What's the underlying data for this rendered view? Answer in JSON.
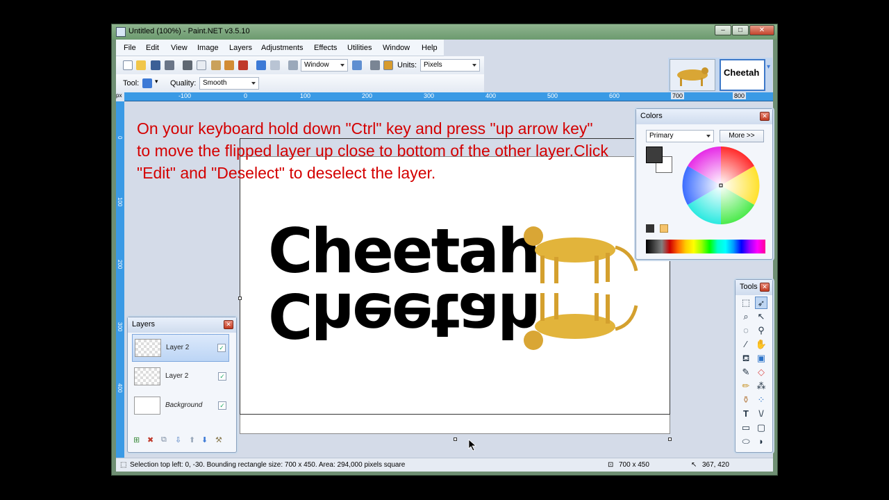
{
  "window": {
    "title": "Untitled (100%) - Paint.NET v3.5.10",
    "buttons": {
      "minimize": "–",
      "maximize": "□",
      "close": "✕"
    }
  },
  "menu": [
    "File",
    "Edit",
    "View",
    "Image",
    "Layers",
    "Adjustments",
    "Effects",
    "Utilities",
    "Window",
    "Help"
  ],
  "toolbar": {
    "window_combo": "Window",
    "units_label": "Units:",
    "units_value": "Pixels",
    "tool_label": "Tool:",
    "quality_label": "Quality:",
    "quality_value": "Smooth"
  },
  "ruler": {
    "unit": "px",
    "h_ticks": [
      "-100",
      "0",
      "100",
      "200",
      "300",
      "400",
      "500",
      "600",
      "700",
      "800"
    ],
    "v_ticks": [
      "0",
      "100",
      "200",
      "300",
      "400"
    ]
  },
  "instruction": "On your keyboard hold down \"Ctrl\" key and press \"up arrow key\" to move the flipped layer up close to bottom of the other layer.Click \"Edit\" and \"Deselect\" to deselect the layer.",
  "canvas": {
    "word": "Cheetah",
    "reflection": "Cheetah"
  },
  "colors_panel": {
    "title": "Colors",
    "primary_combo": "Primary",
    "more_button": "More >>",
    "primary_color": "#3c3c3c",
    "secondary_color": "#ffffff"
  },
  "layers_panel": {
    "title": "Layers",
    "layers": [
      {
        "name": "Layer 2",
        "visible": true,
        "selected": true
      },
      {
        "name": "Layer 2",
        "visible": true,
        "selected": false
      },
      {
        "name": "Background",
        "visible": true,
        "selected": false
      }
    ]
  },
  "tools_panel": {
    "title": "Tools"
  },
  "status": {
    "text": "Selection top left: 0, -30. Bounding rectangle size: 700 x 450. Area: 294,000 pixels square",
    "size": "700 x 450",
    "position": "367, 420"
  }
}
